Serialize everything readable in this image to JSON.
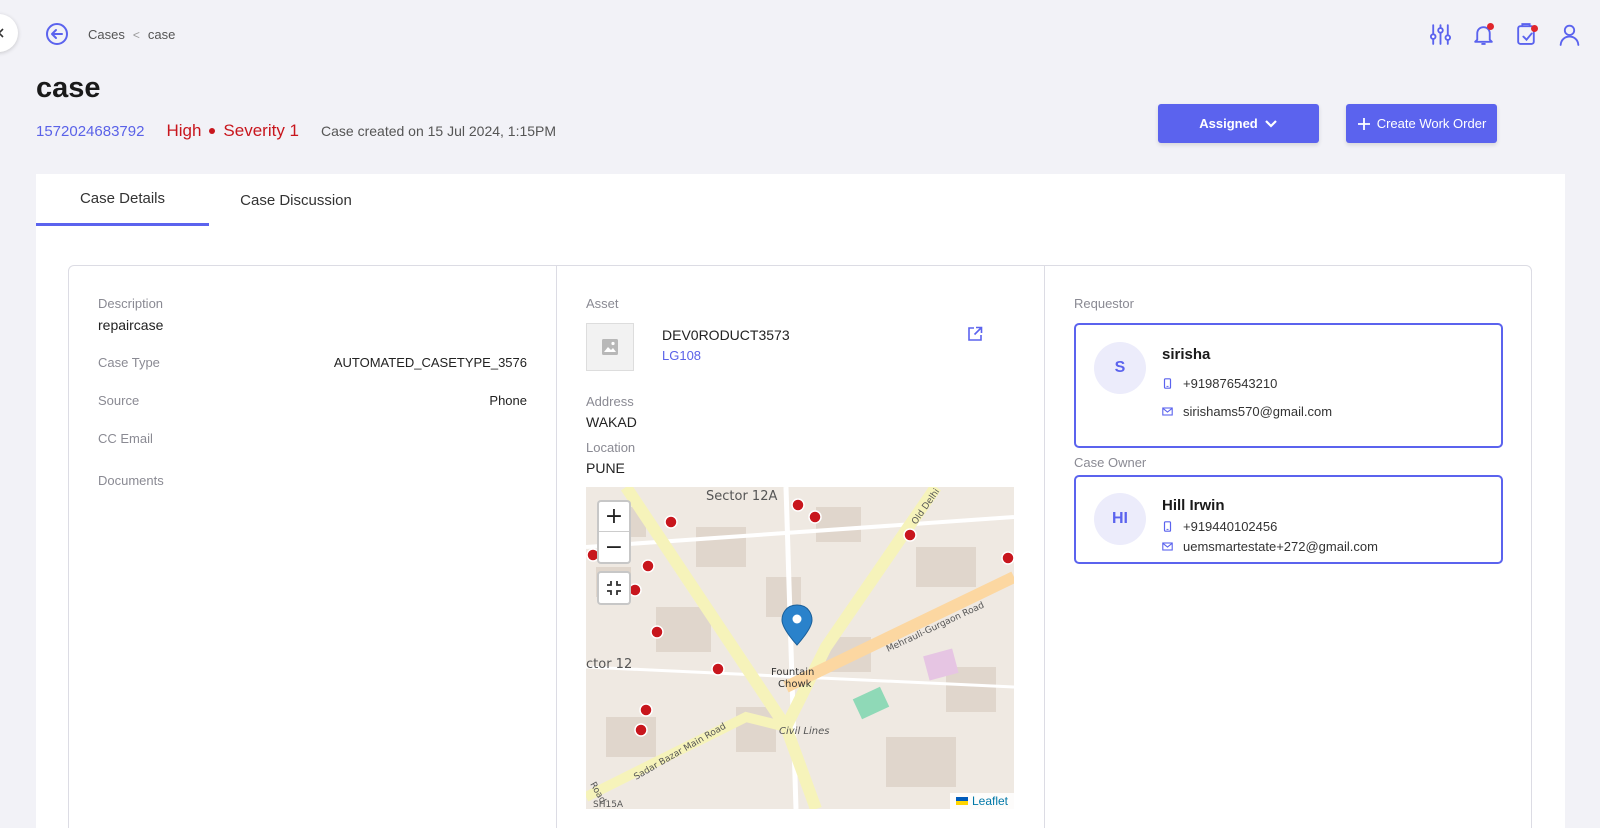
{
  "breadcrumb": {
    "parent": "Cases",
    "current": "case"
  },
  "case": {
    "title": "case",
    "id": "1572024683792",
    "priority": "High",
    "severity": "Severity 1",
    "created": "Case created on 15 Jul 2024, 1:15PM"
  },
  "actions": {
    "status_label": "Assigned",
    "create_label": "Create Work Order"
  },
  "tabs": [
    {
      "label": "Case Details"
    },
    {
      "label": "Case Discussion"
    }
  ],
  "details": {
    "description_label": "Description",
    "description": "repaircase",
    "case_type_label": "Case Type",
    "case_type": "AUTOMATED_CASETYPE_3576",
    "source_label": "Source",
    "source": "Phone",
    "cc_email_label": "CC Email",
    "documents_label": "Documents"
  },
  "asset": {
    "label": "Asset",
    "name": "DEV0RODUCT3573",
    "code": "LG108",
    "address_label": "Address",
    "address": "WAKAD",
    "location_label": "Location",
    "location": "PUNE"
  },
  "map": {
    "zoom_in": "+",
    "zoom_out": "−",
    "attribution": "Leaflet",
    "places": {
      "sector_12a": "Sector 12A",
      "sector_12": "ctor 12",
      "fountain": "Fountain",
      "chowk": "Chowk",
      "civil_lines": "Civil Lines",
      "old_delhi": "Old Delhi",
      "mehrauli": "Mehrauli-Gurgaon Road",
      "sadar": "Sadar Bazar Main Road",
      "road": "Road",
      "sh15a": "SH15A"
    }
  },
  "requestor": {
    "label": "Requestor",
    "initial": "S",
    "name": "sirisha",
    "phone": "+919876543210",
    "email": "sirishams570@gmail.com"
  },
  "owner": {
    "label": "Case Owner",
    "initial": "HI",
    "name": "Hill Irwin",
    "phone": "+919440102456",
    "email": "uemsmartestate+272@gmail.com"
  },
  "colors": {
    "accent": "#5b63ee",
    "danger": "#c8161d",
    "link": "#5a62e8"
  }
}
